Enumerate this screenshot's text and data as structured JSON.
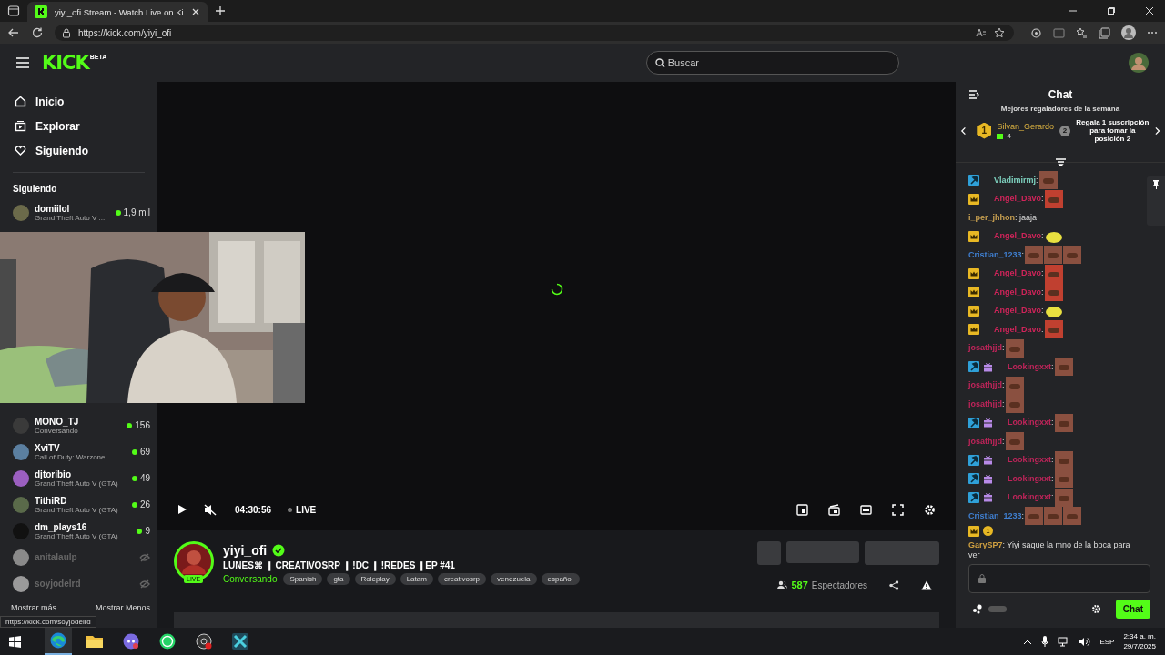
{
  "browser": {
    "tab_title": "yiyi_ofi Stream - Watch Live on Ki",
    "url": "https://kick.com/yiyi_ofi",
    "status_url": "https://kick.com/soyjodelrd"
  },
  "header": {
    "logo": "KICK",
    "logo_tag": "BETA",
    "search_placeholder": "Buscar"
  },
  "sidebar": {
    "nav": [
      {
        "kind": "home",
        "label": "Inicio"
      },
      {
        "kind": "explore",
        "label": "Explorar"
      },
      {
        "kind": "heart",
        "label": "Siguiendo"
      }
    ],
    "following_title": "Siguiendo",
    "following_top": [
      {
        "name": "domiilol",
        "category": "Grand Theft Auto V ...",
        "viewers": "1,9 mil",
        "live": true,
        "color": "#6b6a4a"
      }
    ],
    "following_bottom": [
      {
        "name": "MONO_TJ",
        "category": "Conversando",
        "viewers": "156",
        "live": true,
        "color": "#3a3a3a"
      },
      {
        "name": "XviTV",
        "category": "Call of Duty: Warzone",
        "viewers": "69",
        "live": true,
        "color": "#5b7fa0"
      },
      {
        "name": "djtoribio",
        "category": "Grand Theft Auto V (GTA)",
        "viewers": "49",
        "live": true,
        "color": "#9b5fc0"
      },
      {
        "name": "TithiRD",
        "category": "Grand Theft Auto V (GTA)",
        "viewers": "26",
        "live": true,
        "color": "#5a6a4a"
      },
      {
        "name": "dm_plays16",
        "category": "Grand Theft Auto V (GTA)",
        "viewers": "9",
        "live": true,
        "color": "#111111"
      },
      {
        "name": "anitalaulp",
        "live": false,
        "color": "#8a8a8a"
      },
      {
        "name": "soyjodelrd",
        "live": false,
        "color": "#9a9a9a"
      }
    ],
    "show_more": "Mostrar más",
    "show_less": "Mostrar Menos"
  },
  "player": {
    "time": "04:30:56",
    "live_label": "LIVE",
    "loading": true
  },
  "stream": {
    "channel": "yiyi_ofi",
    "verified": true,
    "live_badge": "LIVE",
    "title": "LUNES⌘ ❙ CREATIVOSRP ❙ !DC ❙ !REDES ❙EP #41",
    "category": "Conversando",
    "tags": [
      "Spanish",
      "gta",
      "Roleplay",
      "Latam",
      "creativosrp",
      "venezuela",
      "español"
    ],
    "viewers": "587",
    "viewers_label": "Espectadores"
  },
  "chat": {
    "title": "Chat",
    "leaderboard_title": "Mejores regaladores de la semana",
    "top_gifter": {
      "rank": "1",
      "name": "Silvan_Gerardo",
      "count": "4"
    },
    "next_rank": "2",
    "cta": "Regala 1 suscripción para tomar la posición 2",
    "messages": [
      {
        "badges": [
          {
            "kind": "moderator"
          }
        ],
        "user": "Vladimirmj",
        "color": "#7fd3c0",
        "text": ":",
        "emotes": [
          {
            "kind": "face"
          }
        ]
      },
      {
        "badges": [
          {
            "kind": "crown"
          }
        ],
        "user": "Angel_Davo",
        "color": "#d0245a",
        "text": ":",
        "emotes": [
          {
            "kind": "red"
          }
        ]
      },
      {
        "user": "i_per_jhhon",
        "color": "#c8a050",
        "text": ": jaaja"
      },
      {
        "badges": [
          {
            "kind": "crown"
          }
        ],
        "user": "Angel_Davo",
        "color": "#d0245a",
        "text": ":",
        "emotes": [
          {
            "kind": "blob"
          }
        ]
      },
      {
        "user": "Cristian_1233",
        "color": "#3f7fd0",
        "text": ":",
        "emotes": [
          {
            "kind": "face"
          },
          {
            "kind": "face"
          },
          {
            "kind": "face"
          }
        ]
      },
      {
        "badges": [
          {
            "kind": "crown"
          }
        ],
        "user": "Angel_Davo",
        "color": "#d0245a",
        "text": ":",
        "emotes": [
          {
            "kind": "red"
          }
        ]
      },
      {
        "badges": [
          {
            "kind": "crown"
          }
        ],
        "user": "Angel_Davo",
        "color": "#d0245a",
        "text": ":",
        "emotes": [
          {
            "kind": "red"
          }
        ]
      },
      {
        "badges": [
          {
            "kind": "crown"
          }
        ],
        "user": "Angel_Davo",
        "color": "#d0245a",
        "text": ":",
        "emotes": [
          {
            "kind": "blob"
          }
        ]
      },
      {
        "badges": [
          {
            "kind": "crown"
          }
        ],
        "user": "Angel_Davo",
        "color": "#d0245a",
        "text": ":",
        "emotes": [
          {
            "kind": "red"
          }
        ]
      },
      {
        "user": "josathjjd",
        "color": "#c0245a",
        "text": ":",
        "emotes": [
          {
            "kind": "face"
          }
        ]
      },
      {
        "badges": [
          {
            "kind": "moderator"
          },
          {
            "kind": "gift"
          }
        ],
        "user": "Lookingxxt",
        "color": "#c0245a",
        "text": ":",
        "emotes": [
          {
            "kind": "face"
          }
        ]
      },
      {
        "user": "josathjjd",
        "color": "#c0245a",
        "text": ":",
        "emotes": [
          {
            "kind": "face"
          }
        ]
      },
      {
        "user": "josathjjd",
        "color": "#c0245a",
        "text": ":",
        "emotes": [
          {
            "kind": "face"
          }
        ]
      },
      {
        "badges": [
          {
            "kind": "moderator"
          },
          {
            "kind": "gift"
          }
        ],
        "user": "Lookingxxt",
        "color": "#c0245a",
        "text": ":",
        "emotes": [
          {
            "kind": "face"
          }
        ]
      },
      {
        "user": "josathjjd",
        "color": "#c0245a",
        "text": ":",
        "emotes": [
          {
            "kind": "face"
          }
        ]
      },
      {
        "badges": [
          {
            "kind": "moderator"
          },
          {
            "kind": "gift"
          }
        ],
        "user": "Lookingxxt",
        "color": "#c0245a",
        "text": ":",
        "emotes": [
          {
            "kind": "face"
          }
        ]
      },
      {
        "badges": [
          {
            "kind": "moderator"
          },
          {
            "kind": "gift"
          }
        ],
        "user": "Lookingxxt",
        "color": "#c0245a",
        "text": ":",
        "emotes": [
          {
            "kind": "face"
          }
        ]
      },
      {
        "badges": [
          {
            "kind": "moderator"
          },
          {
            "kind": "gift"
          }
        ],
        "user": "Lookingxxt",
        "color": "#c0245a",
        "text": ":",
        "emotes": [
          {
            "kind": "face"
          }
        ]
      },
      {
        "user": "Cristian_1233",
        "color": "#3f7fd0",
        "text": ":",
        "emotes": [
          {
            "kind": "face"
          },
          {
            "kind": "face"
          },
          {
            "kind": "face"
          }
        ]
      },
      {
        "badges": [
          {
            "kind": "crown"
          }
        ],
        "rank": "1",
        "user": "GarySP7",
        "color": "#d0a040",
        "text": ": Yiyi saque la mno de la boca para ver"
      }
    ],
    "send_label": "Chat"
  },
  "taskbar": {
    "language": "ESP",
    "time": "2:34 a. m.",
    "date": "29/7/2025"
  }
}
